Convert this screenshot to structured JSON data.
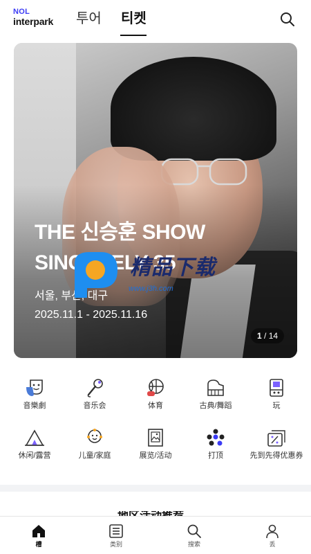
{
  "header": {
    "logo_line1": "NOL",
    "logo_line2": "interpark",
    "tabs": [
      {
        "label": "투어",
        "active": false
      },
      {
        "label": "티켓",
        "active": true
      }
    ],
    "search_icon": "search-icon"
  },
  "hero": {
    "title": "THE 신승훈 SHOW SINCERELY 35",
    "venue": "서울, 부산, 대구",
    "dates": "2025.11.1 - 2025.11.16",
    "pager_current": "1",
    "pager_sep": " / ",
    "pager_total": "14"
  },
  "watermark": {
    "text": "精品下载",
    "url": "www.j3h.com"
  },
  "categories": [
    {
      "label": "音樂劇",
      "icon": "theater-mask-icon"
    },
    {
      "label": "音乐会",
      "icon": "microphone-icon"
    },
    {
      "label": "体育",
      "icon": "basketball-icon"
    },
    {
      "label": "古典/舞蹈",
      "icon": "piano-icon"
    },
    {
      "label": "玩",
      "icon": "arcade-icon"
    },
    {
      "label": "休闲/露营",
      "icon": "tent-icon"
    },
    {
      "label": "儿童/家庭",
      "icon": "child-icon"
    },
    {
      "label": "展览/活动",
      "icon": "picture-frame-icon"
    },
    {
      "label": "打顶",
      "icon": "dots-cluster-icon"
    },
    {
      "label": "先到先得优惠券",
      "icon": "coupon-icon"
    }
  ],
  "section_peek": "地区活动推荐",
  "bottom_nav": [
    {
      "label": "槽",
      "icon": "home-icon",
      "active": true
    },
    {
      "label": "类别",
      "icon": "list-icon",
      "active": false
    },
    {
      "label": "搜索",
      "icon": "search-icon",
      "active": false
    },
    {
      "label": "丢",
      "icon": "person-icon",
      "active": false
    }
  ],
  "colors": {
    "brand_blue": "#3b3bf5",
    "accent_orange": "#f5a623",
    "icon_dark": "#333333",
    "icon_purple": "#7b61ff"
  }
}
